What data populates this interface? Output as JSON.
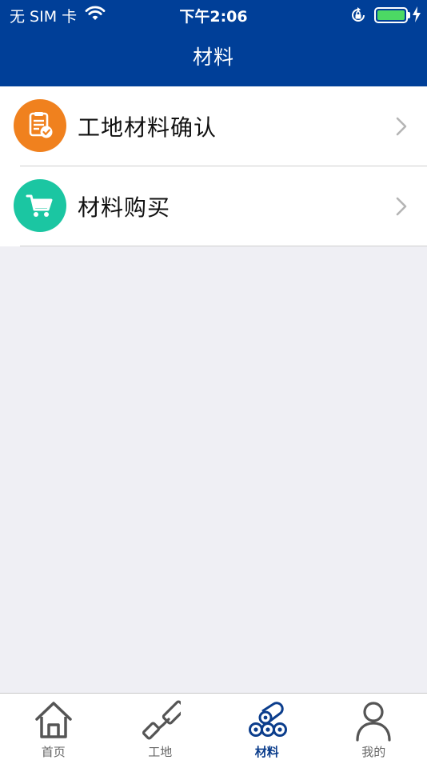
{
  "status_bar": {
    "carrier": "无 SIM 卡",
    "time": "下午2:06"
  },
  "nav": {
    "title": "材料"
  },
  "colors": {
    "nav_bg": "#003f98",
    "orange": "#f0811e",
    "teal": "#1bc6a2",
    "active_tab": "#0b3d8c"
  },
  "menu": {
    "items": [
      {
        "label": "工地材料确认",
        "icon": "clipboard-check-icon"
      },
      {
        "label": "材料购买",
        "icon": "shopping-cart-icon"
      }
    ]
  },
  "tabbar": {
    "tabs": [
      {
        "label": "首页",
        "icon": "home-icon"
      },
      {
        "label": "工地",
        "icon": "paint-roller-icon"
      },
      {
        "label": "材料",
        "icon": "material-rolls-icon",
        "active": true
      },
      {
        "label": "我的",
        "icon": "person-icon"
      }
    ]
  }
}
